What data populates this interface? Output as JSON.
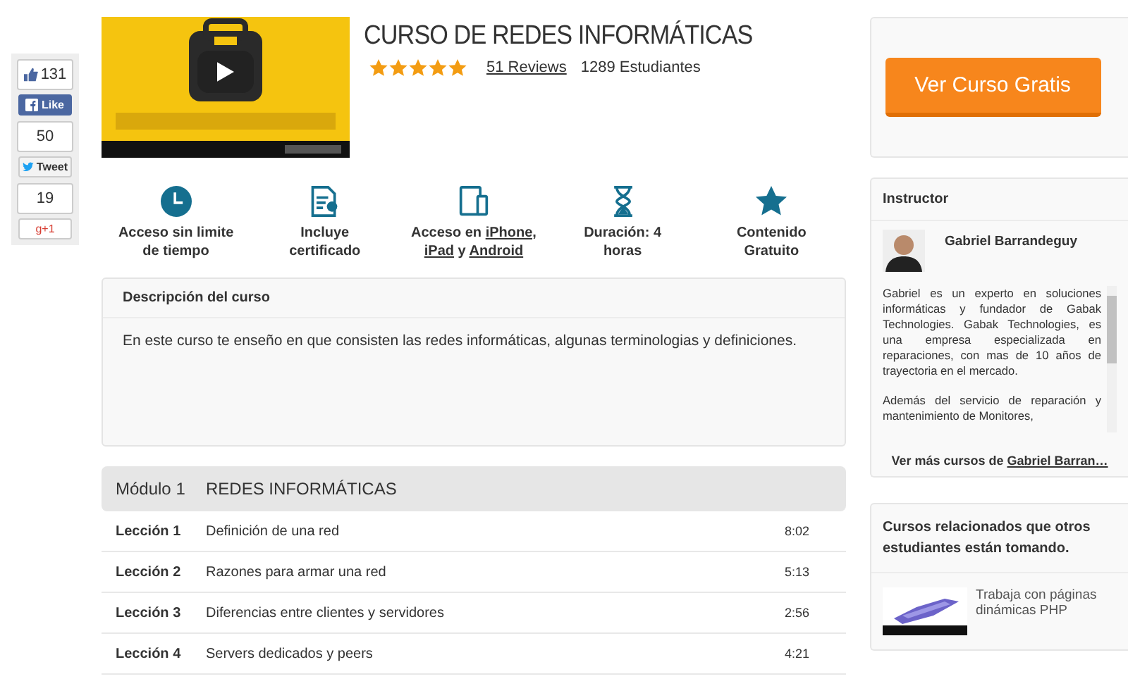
{
  "social": [
    {
      "kind": "facebook",
      "count": "131",
      "label": "Like"
    },
    {
      "kind": "twitter",
      "count": "50",
      "label": "Tweet"
    },
    {
      "kind": "google",
      "count": "19",
      "label": "g+1"
    }
  ],
  "course": {
    "title": "CURSO DE REDES INFORMÁTICAS",
    "stars": 5,
    "reviews": "51 Reviews",
    "students": "1289 Estudiantes"
  },
  "features": [
    {
      "kind": "clock",
      "text": "Acceso sin limite de tiempo"
    },
    {
      "kind": "certificate",
      "text": "Incluye certificado"
    },
    {
      "kind": "tablet",
      "text": "Acceso en",
      "links": [
        "iPhone,",
        "iPad",
        "Android"
      ],
      "joiner": "y"
    },
    {
      "kind": "hourglass",
      "text": "Duración: 4 horas"
    },
    {
      "kind": "star",
      "text": "Contenido Gratuito"
    }
  ],
  "description": {
    "title": "Descripción del curso",
    "text": "En este curso te enseño en que consisten las redes informáticas, algunas terminologias y definiciones."
  },
  "module": {
    "label": "Módulo 1",
    "title": "REDES INFORMÁTICAS",
    "lessons": [
      {
        "label": "Lección 1",
        "title": "Definición de una red",
        "duration": "8:02"
      },
      {
        "label": "Lección 2",
        "title": "Razones para armar una red",
        "duration": "5:13"
      },
      {
        "label": "Lección 3",
        "title": "Diferencias entre clientes y servidores",
        "duration": "2:56"
      },
      {
        "label": "Lección 4",
        "title": "Servers dedicados y peers",
        "duration": "4:21"
      }
    ]
  },
  "cta": {
    "label": "Ver Curso Gratis"
  },
  "instructor": {
    "heading": "Instructor",
    "name": "Gabriel Barrandeguy",
    "bio": [
      "Gabriel es un experto en soluciones informáticas y fundador de Gabak Technologies. Gabak Technologies, es una empresa especializada en reparaciones, con mas de 10 años de trayectoria en el mercado.",
      "Además del servicio de reparación y mantenimiento de Monitores,"
    ],
    "more_prefix": "Ver más cursos de ",
    "more_link": "Gabriel Barran…"
  },
  "related": {
    "heading": "Cursos relacionados que otros estudiantes están tomando.",
    "items": [
      {
        "title": "Trabaja con páginas dinámicas PHP"
      }
    ]
  }
}
